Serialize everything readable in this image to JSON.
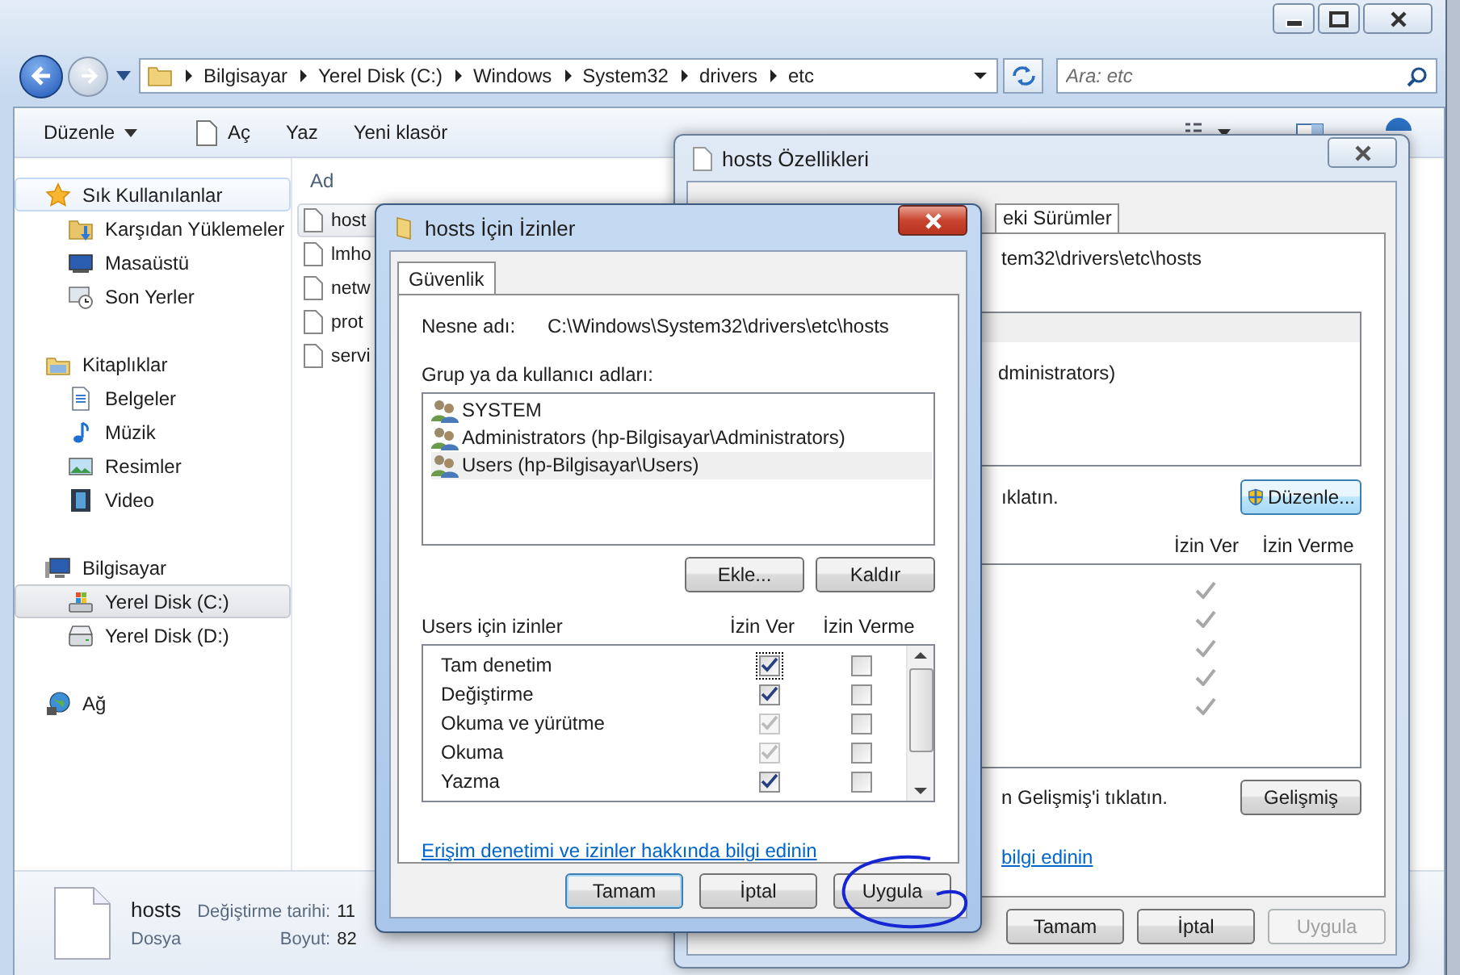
{
  "explorer": {
    "breadcrumb": [
      "Bilgisayar",
      "Yerel Disk (C:)",
      "Windows",
      "System32",
      "drivers",
      "etc"
    ],
    "search": {
      "placeholder": "Ara: etc"
    },
    "toolbar": [
      {
        "label": "Düzenle",
        "kind": "menu"
      },
      {
        "label": "Aç",
        "kind": "open"
      },
      {
        "label": "Yaz",
        "kind": "plain"
      },
      {
        "label": "Yeni klasör",
        "kind": "plain"
      }
    ],
    "sidebar": [
      {
        "label": "Sık Kullanılanlar",
        "selected": false,
        "hover": true,
        "children": [
          {
            "label": "Karşıdan Yüklemeler",
            "selected": false,
            "hover": false
          },
          {
            "label": "Masaüstü",
            "selected": false,
            "hover": false
          },
          {
            "label": "Son Yerler",
            "selected": false,
            "hover": false
          }
        ]
      },
      {
        "label": "Kitaplıklar",
        "selected": false,
        "hover": false,
        "children": [
          {
            "label": "Belgeler",
            "selected": false,
            "hover": false
          },
          {
            "label": "Müzik",
            "selected": false,
            "hover": false
          },
          {
            "label": "Resimler",
            "selected": false,
            "hover": false
          },
          {
            "label": "Video",
            "selected": false,
            "hover": false
          }
        ]
      },
      {
        "label": "Bilgisayar",
        "selected": false,
        "hover": false,
        "children": [
          {
            "label": "Yerel Disk (C:)",
            "selected": true,
            "hover": false
          },
          {
            "label": "Yerel Disk (D:)",
            "selected": false,
            "hover": false
          }
        ]
      },
      {
        "label": "Ağ",
        "selected": false,
        "hover": false
      }
    ],
    "column": "Ad",
    "files": [
      {
        "name": "host",
        "selected": true
      },
      {
        "name": "lmho",
        "selected": false
      },
      {
        "name": "netw",
        "selected": false
      },
      {
        "name": "prot",
        "selected": false
      },
      {
        "name": "servi",
        "selected": false
      }
    ],
    "details": {
      "name": "hosts",
      "type": "Dosya",
      "modified_label": "Değiştirme tarihi:",
      "modified": "11",
      "size_label": "Boyut:",
      "size": "82"
    }
  },
  "properties": {
    "title": "hosts Özellikleri",
    "tab": "eki Sürümler",
    "object_path": "tem32\\drivers\\etc\\hosts",
    "groups": [
      {
        "selected": true
      },
      {
        "name": "dministrators)",
        "selected": false
      }
    ],
    "edit_hint": "ıklatın.",
    "edit_button": "Düzenle...",
    "allow_header": "İzin Ver",
    "deny_header": "İzin Verme",
    "permissions": [
      {
        "allow": true
      },
      {
        "allow": true
      },
      {
        "allow": true
      },
      {
        "allow": true
      },
      {
        "allow": true
      }
    ],
    "advanced_hint": "n Gelişmiş'i tıklatın.",
    "advanced_button": "Gelişmiş",
    "link": "bilgi edinin",
    "buttons": [
      {
        "label": "Tamam",
        "disabled": false
      },
      {
        "label": "İptal",
        "disabled": false
      },
      {
        "label": "Uygula",
        "disabled": true
      }
    ]
  },
  "permissions": {
    "title": "hosts İçin İzinler",
    "tab": "Güvenlik",
    "object_label": "Nesne adı:",
    "object_path": "C:\\Windows\\System32\\drivers\\etc\\hosts",
    "groups_label": "Grup ya da kullanıcı adları:",
    "groups": [
      {
        "name": "SYSTEM",
        "selected": false
      },
      {
        "name": "Administrators (hp-Bilgisayar\\Administrators)",
        "selected": false
      },
      {
        "name": "Users (hp-Bilgisayar\\Users)",
        "selected": true
      }
    ],
    "group_buttons": [
      "Ekle...",
      "Kaldır"
    ],
    "perm_label": "Users için izinler",
    "allow_header": "İzin Ver",
    "deny_header": "İzin Verme",
    "rows": [
      {
        "label": "Tam denetim",
        "allow": true,
        "allow_disabled": false,
        "deny": false,
        "focused": true
      },
      {
        "label": "Değiştirme",
        "allow": true,
        "allow_disabled": false,
        "deny": false,
        "focused": false
      },
      {
        "label": "Okuma ve yürütme",
        "allow": true,
        "allow_disabled": true,
        "deny": false,
        "focused": false
      },
      {
        "label": "Okuma",
        "allow": true,
        "allow_disabled": true,
        "deny": false,
        "focused": false
      },
      {
        "label": "Yazma",
        "allow": true,
        "allow_disabled": false,
        "deny": false,
        "focused": false
      }
    ],
    "link": "Erişim denetimi ve izinler hakkında bilgi edinin",
    "buttons": [
      {
        "label": "Tamam",
        "default": true
      },
      {
        "label": "İptal",
        "default": false
      },
      {
        "label": "Uygula",
        "default": false
      }
    ]
  }
}
